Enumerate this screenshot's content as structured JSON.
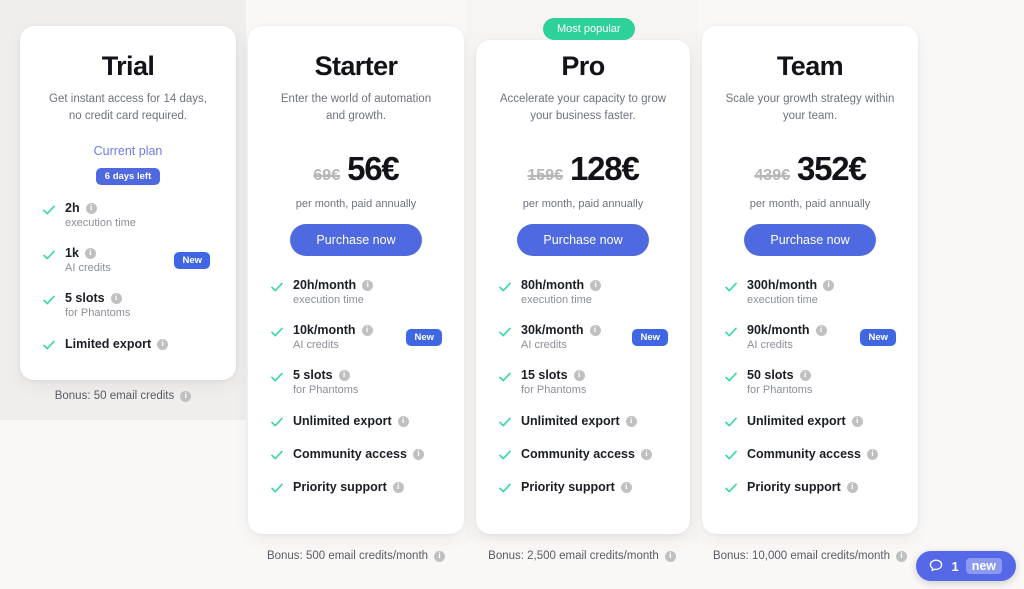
{
  "colors": {
    "page_background": "#faf8f7",
    "card_background": "#ffffff",
    "accent_blue": "#4f6ae0",
    "badge_green": "#2fd19a",
    "check_green": "#3fd9a0",
    "new_badge_blue": "#3f66e3",
    "chat_blue": "#5468e8",
    "chat_new_lavender": "#8c99f0"
  },
  "popular_badge": {
    "label": "Most popular"
  },
  "info_icon": {
    "glyph": "i",
    "name": "info-icon"
  },
  "plans": [
    {
      "id": "trial",
      "name": "Trial",
      "description": "Get instant access for 14 days, no credit card required.",
      "current_plan_label": "Current plan",
      "days_left_badge": "6 days left",
      "bonus": "Bonus: 50 email credits",
      "features": [
        {
          "main": "2h",
          "sub": "execution time",
          "info": true,
          "new": false
        },
        {
          "main": "1k",
          "sub": "AI credits",
          "info": true,
          "new": true,
          "new_label": "New"
        },
        {
          "main": "5 slots",
          "sub": "for Phantoms",
          "info": true,
          "new": false
        },
        {
          "main": "Limited export",
          "sub": "",
          "info": true,
          "new": false
        }
      ]
    },
    {
      "id": "starter",
      "name": "Starter",
      "description": "Enter the world of automation and growth.",
      "price_old": "69€",
      "price_new": "56€",
      "price_note": "per month, paid annually",
      "cta_label": "Purchase now",
      "bonus": "Bonus: 500 email credits/month",
      "features": [
        {
          "main": "20h/month",
          "sub": "execution time",
          "info": true,
          "new": false
        },
        {
          "main": "10k/month",
          "sub": "AI credits",
          "info": true,
          "new": true,
          "new_label": "New"
        },
        {
          "main": "5 slots",
          "sub": "for Phantoms",
          "info": true,
          "new": false
        },
        {
          "main": "Unlimited export",
          "sub": "",
          "info": true,
          "new": false
        },
        {
          "main": "Community access",
          "sub": "",
          "info": true,
          "new": false
        },
        {
          "main": "Priority support",
          "sub": "",
          "info": true,
          "new": false
        }
      ]
    },
    {
      "id": "pro",
      "name": "Pro",
      "description": "Accelerate your capacity to grow your business faster.",
      "price_old": "159€",
      "price_new": "128€",
      "price_note": "per month, paid annually",
      "cta_label": "Purchase now",
      "bonus": "Bonus: 2,500 email credits/month",
      "features": [
        {
          "main": "80h/month",
          "sub": "execution time",
          "info": true,
          "new": false
        },
        {
          "main": "30k/month",
          "sub": "AI credits",
          "info": true,
          "new": true,
          "new_label": "New"
        },
        {
          "main": "15 slots",
          "sub": "for Phantoms",
          "info": true,
          "new": false
        },
        {
          "main": "Unlimited export",
          "sub": "",
          "info": true,
          "new": false
        },
        {
          "main": "Community access",
          "sub": "",
          "info": true,
          "new": false
        },
        {
          "main": "Priority support",
          "sub": "",
          "info": true,
          "new": false
        }
      ]
    },
    {
      "id": "team",
      "name": "Team",
      "description": "Scale your growth strategy within your team.",
      "price_old": "439€",
      "price_new": "352€",
      "price_note": "per month, paid annually",
      "cta_label": "Purchase now",
      "bonus": "Bonus: 10,000 email credits/month",
      "features": [
        {
          "main": "300h/month",
          "sub": "execution time",
          "info": true,
          "new": false
        },
        {
          "main": "90k/month",
          "sub": "AI credits",
          "info": true,
          "new": true,
          "new_label": "New"
        },
        {
          "main": "50 slots",
          "sub": "for Phantoms",
          "info": true,
          "new": false
        },
        {
          "main": "Unlimited export",
          "sub": "",
          "info": true,
          "new": false
        },
        {
          "main": "Community access",
          "sub": "",
          "info": true,
          "new": false
        },
        {
          "main": "Priority support",
          "sub": "",
          "info": true,
          "new": false
        }
      ]
    }
  ],
  "chat_widget": {
    "count": "1",
    "new_label": "new",
    "icon": "chat-bubble-icon"
  }
}
